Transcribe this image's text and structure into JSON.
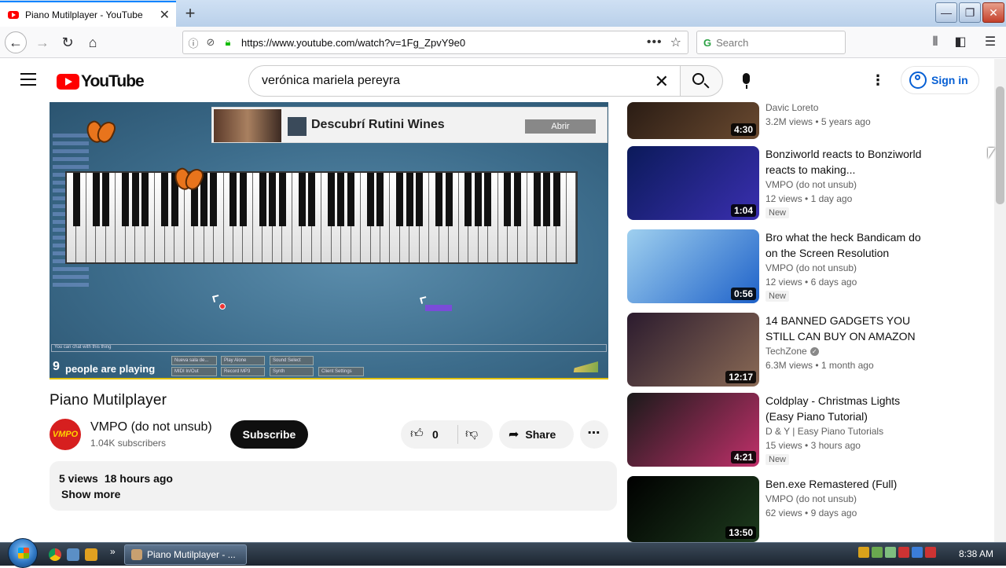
{
  "browser": {
    "tab_title": "Piano Mutilplayer - YouTube",
    "url": "https://www.youtube.com/watch?v=1Fg_ZpvY9e0",
    "search_placeholder": "Search"
  },
  "youtube": {
    "logo_text": "YouTube",
    "search_query": "verónica mariela pereyra",
    "sign_in_label": "Sign in"
  },
  "player": {
    "ad_headline": "Descubrí Rutini Wines",
    "ad_cta": "Abrir",
    "chat_hint": "You can chat with this thing",
    "players_count": "9",
    "players_label": "people are playing",
    "game_buttons": [
      "Nueva sala de...",
      "Play Alone",
      "Sound Select",
      "MIDI In/Out",
      "Record MP3",
      "Synth",
      "Client Settings"
    ]
  },
  "video": {
    "title": "Piano Mutilplayer",
    "channel_name": "VMPO (do not unsub)",
    "channel_avatar_text": "VMPO",
    "subscribers": "1.04K subscribers",
    "subscribe_label": "Subscribe",
    "like_count": "0",
    "share_label": "Share",
    "views": "5 views",
    "uploaded": "18 hours ago",
    "show_more": "Show more"
  },
  "recommendations": [
    {
      "title": "",
      "channel": "Davic Loreto",
      "views": "3.2M views",
      "age": "5 years ago",
      "duration": "4:30",
      "badge": "",
      "thumb_colors": [
        "#2a1c14",
        "#6a4a30"
      ]
    },
    {
      "title": "Bonziworld reacts to Bonziworld reacts to making...",
      "channel": "VMPO (do not unsub)",
      "views": "12 views",
      "age": "1 day ago",
      "duration": "1:04",
      "badge": "New",
      "thumb_colors": [
        "#0b1a5a",
        "#3a2fb0"
      ]
    },
    {
      "title": "Bro what the heck Bandicam do on the Screen Resolution",
      "channel": "VMPO (do not unsub)",
      "views": "12 views",
      "age": "6 days ago",
      "duration": "0:56",
      "badge": "New",
      "thumb_colors": [
        "#9fd0ef",
        "#1f62c9"
      ]
    },
    {
      "title": "14 BANNED GADGETS YOU STILL CAN BUY ON AMAZON",
      "channel": "TechZone",
      "views": "6.3M views",
      "age": "1 month ago",
      "duration": "12:17",
      "badge": "",
      "thumb_colors": [
        "#2b1b2e",
        "#8a6a55"
      ]
    },
    {
      "title": "Coldplay - Christmas Lights (Easy Piano Tutorial)",
      "channel": "D & Y | Easy Piano Tutorials",
      "views": "15 views",
      "age": "3 hours ago",
      "duration": "4:21",
      "badge": "New",
      "thumb_colors": [
        "#1a1a1a",
        "#c0306a"
      ]
    },
    {
      "title": "Ben.exe Remastered (Full)",
      "channel": "VMPO (do not unsub)",
      "views": "62 views",
      "age": "9 days ago",
      "duration": "13:50",
      "badge": "",
      "thumb_colors": [
        "#000000",
        "#1d3a1d"
      ]
    }
  ],
  "taskbar": {
    "window_label": "Piano Mutilplayer - ...",
    "clock": "8:38 AM"
  }
}
